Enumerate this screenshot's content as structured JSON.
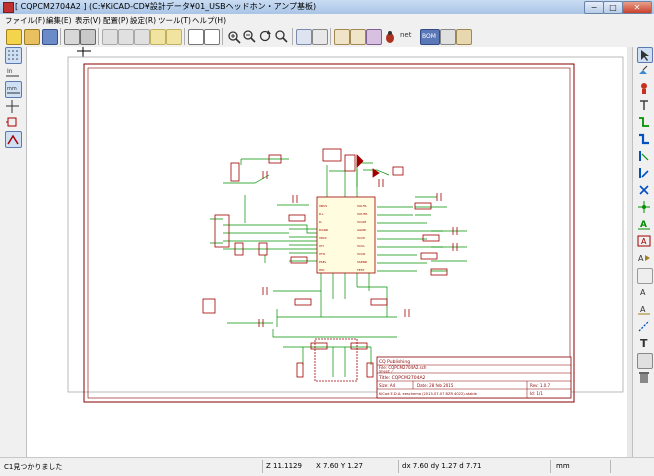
{
  "window": {
    "title": "[ CQPCM2704A2 ] (C:¥KiCAD-CD¥設計データ¥01_USBヘッドホン・アンプ基板)",
    "minimize_label": "−",
    "maximize_label": "□",
    "close_label": "✕"
  },
  "menu": {
    "items": [
      "ファイル(F)",
      "編集(E)",
      "表示(V)",
      "配置(P)",
      "設定(R)",
      "ツール(T)",
      "ヘルプ(H)"
    ]
  },
  "toolbar": {
    "net_label": "net",
    "bom_label": "BOM"
  },
  "title_block": {
    "org": "CQ Publishing",
    "file": "File: CQPCM2704A2.sch",
    "sheet": "Sheet: /",
    "title": "Title: CQPCM2704A2",
    "size": "Size: A4",
    "date": "Date: 28 feb 2015",
    "rev": "Rev: 1.0.7",
    "kicad": "KiCad E.D.A.  eeschema (2013-07-07 BZR 4022)-stable",
    "id": "Id: 1/1"
  },
  "status": {
    "message": "C1見つかりました",
    "zoom": "Z 11.1129",
    "coords": "X 7.60  Y 1.27",
    "delta": "dx 7.60  dy 1.27  d 7.71",
    "units": "mm"
  },
  "colors": {
    "wire": "#009000",
    "component": "#a00000",
    "border": "#880000"
  }
}
